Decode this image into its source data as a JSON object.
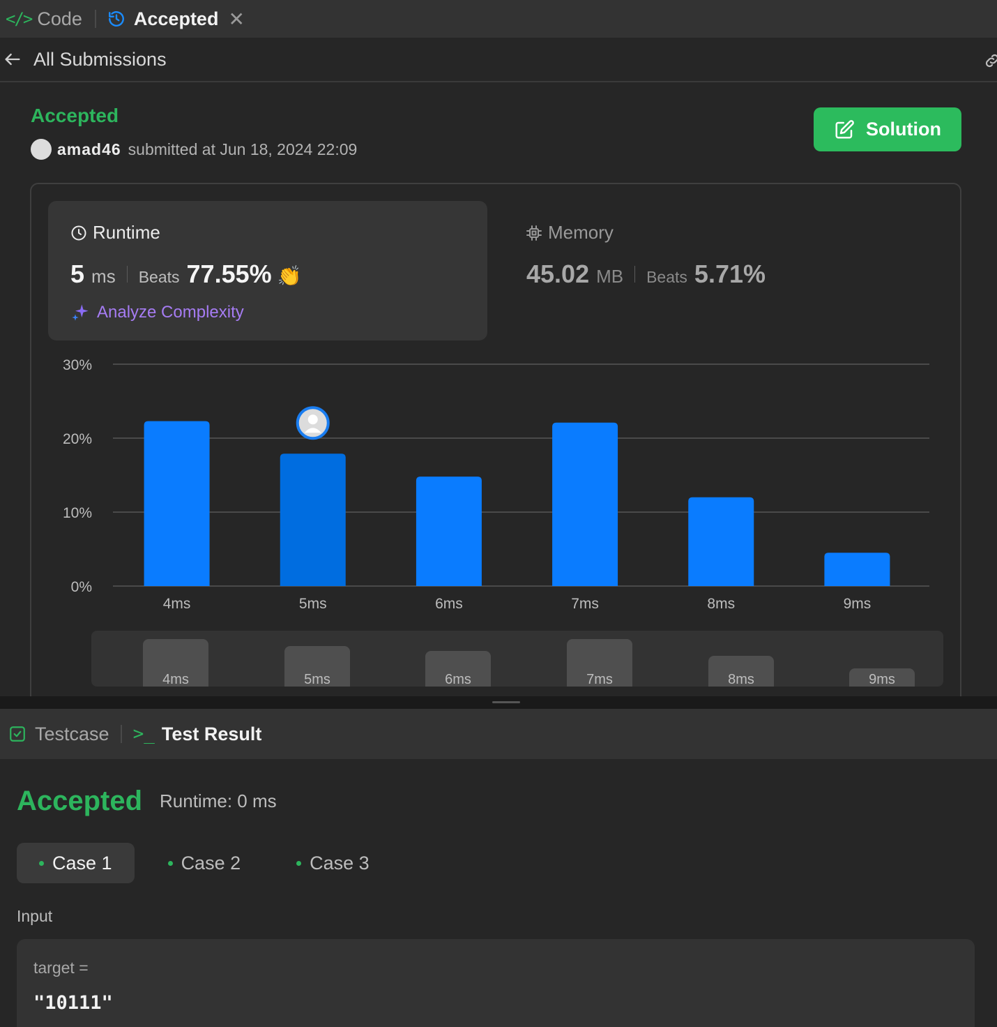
{
  "tabs": {
    "code_label": "Code",
    "accepted_label": "Accepted"
  },
  "header": {
    "title": "All Submissions"
  },
  "submission": {
    "status": "Accepted",
    "username": "amad46",
    "submitted_text": "submitted at Jun 18, 2024 22:09",
    "solution_button": "Solution"
  },
  "runtime": {
    "label": "Runtime",
    "value": "5",
    "unit": "ms",
    "beats_label": "Beats",
    "beats_value": "77.55%",
    "analyze_label": "Analyze Complexity"
  },
  "memory": {
    "label": "Memory",
    "value": "45.02",
    "unit": "MB",
    "beats_label": "Beats",
    "beats_value": "5.71%"
  },
  "chart_data": {
    "type": "bar",
    "categories": [
      "4ms",
      "5ms",
      "6ms",
      "7ms",
      "8ms",
      "9ms"
    ],
    "values": [
      22.3,
      17.9,
      14.8,
      22.1,
      12.0,
      4.5
    ],
    "ylim": [
      0,
      30
    ],
    "yticks": [
      "0%",
      "10%",
      "20%",
      "30%"
    ],
    "ytick_values": [
      0,
      10,
      20,
      30
    ],
    "highlight_index": 1,
    "grid": true,
    "colors": {
      "bar": "#0a7cff",
      "highlight": "#006de0",
      "grid": "#4a4a4a"
    }
  },
  "mini_chart": {
    "labels": [
      "4ms",
      "5ms",
      "6ms",
      "7ms",
      "8ms",
      "9ms"
    ]
  },
  "bottom_tabs": {
    "testcase_label": "Testcase",
    "result_label": "Test Result"
  },
  "result": {
    "status": "Accepted",
    "runtime_text": "Runtime: 0 ms",
    "cases": [
      "Case 1",
      "Case 2",
      "Case 3"
    ],
    "active_case": 0,
    "input_label": "Input",
    "input_var": "target =",
    "input_value": "\"10111\""
  },
  "colors": {
    "accent_green": "#2db55d",
    "accent_blue": "#0a7cff",
    "accent_purple": "#a67cf3"
  }
}
